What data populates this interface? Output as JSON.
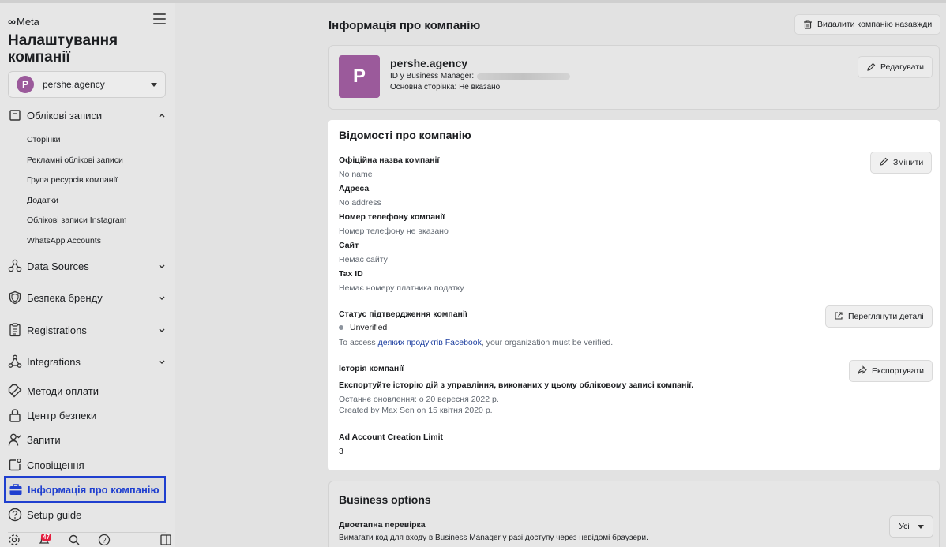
{
  "sidebar": {
    "brand": "Meta",
    "title": "Налаштування компанії",
    "account": {
      "initial": "P",
      "name": "pershe.agency"
    },
    "accounts_group": "Облікові записи",
    "sub_items": [
      "Сторінки",
      "Рекламні облікові записи",
      "Група ресурсів компанії",
      "Додатки",
      "Облікові записи Instagram",
      "WhatsApp Accounts"
    ],
    "groups": [
      {
        "label": "Data Sources",
        "icon": "data-sources-icon"
      },
      {
        "label": "Безпека бренду",
        "icon": "shield-icon"
      },
      {
        "label": "Registrations",
        "icon": "clipboard-icon"
      },
      {
        "label": "Integrations",
        "icon": "integrations-icon"
      }
    ],
    "items": [
      {
        "label": "Методи оплати",
        "icon": "payment-tag-icon"
      },
      {
        "label": "Центр безпеки",
        "icon": "lock-icon"
      },
      {
        "label": "Запити",
        "icon": "person-check-icon"
      },
      {
        "label": "Сповіщення",
        "icon": "notification-icon"
      },
      {
        "label": "Інформація про компанію",
        "icon": "briefcase-icon"
      },
      {
        "label": "Setup guide",
        "icon": "question-circle-icon"
      }
    ],
    "notification_badge": "47"
  },
  "header": {
    "title": "Інформація про компанію",
    "delete_label": "Видалити компанію назавжди"
  },
  "company": {
    "initial": "P",
    "name": "pershe.agency",
    "id_label": "ID у Business Manager:",
    "main_page": "Основна сторінка: Не вказано",
    "edit_label": "Редагувати"
  },
  "details": {
    "title": "Відомості про компанію",
    "change_label": "Змінити",
    "fields": [
      {
        "label": "Офіційна назва компанії",
        "value": "No name"
      },
      {
        "label": "Адреса",
        "value": "No address"
      },
      {
        "label": "Номер телефону компанії",
        "value": "Номер телефону не вказано"
      },
      {
        "label": "Сайт",
        "value": "Немає сайту"
      },
      {
        "label": "Tax ID",
        "value": "Немає номеру платника податку"
      }
    ],
    "verification": {
      "label": "Статус підтвердження компанії",
      "status": "Unverified",
      "access_prefix": "To access ",
      "access_link": "деяких продуктів Facebook",
      "access_suffix": ", your organization must be verified.",
      "view_label": "Переглянути деталі"
    },
    "history": {
      "label": "Історія компанії",
      "headline": "Експортуйте історію дій з управління, виконаних у цьому обліковому записі компанії.",
      "updated": "Останнє оновлення: о 20 вересня 2022 р.",
      "created": "Created by Max Sen on 15 квітня 2020 р.",
      "export_label": "Експортувати"
    },
    "limit": {
      "label": "Ad Account Creation Limit",
      "value": "3"
    }
  },
  "options": {
    "title": "Business options",
    "two_factor_label": "Двоетапна перевірка",
    "two_factor_desc": "Вимагати код для входу в Business Manager у разі доступу через невідомі браузери.",
    "select_value": "Усі"
  }
}
